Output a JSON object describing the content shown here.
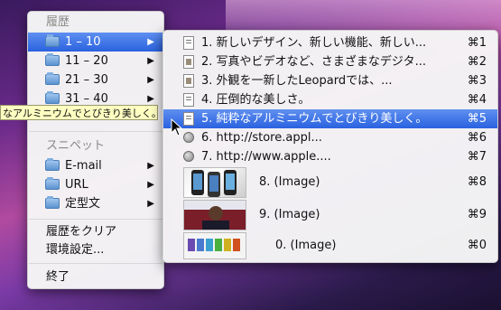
{
  "main_menu": {
    "header_history": "履歴",
    "history_groups": [
      {
        "label": "1 – 10"
      },
      {
        "label": "11 – 20"
      },
      {
        "label": "21 – 30"
      },
      {
        "label": "31 – 40"
      }
    ],
    "header_snippets": "スニペット",
    "snippet_folders": [
      {
        "label": "E-mail"
      },
      {
        "label": "URL"
      },
      {
        "label": "定型文"
      }
    ],
    "clear_history": "履歴をクリア",
    "preferences": "環境設定...",
    "quit": "終了"
  },
  "tooltip": "なアルミニウムでとびきり美しく。",
  "submenu": {
    "items": [
      {
        "label": "1. 新しいデザイン、新しい機能、新しい...",
        "shortcut": "⌘1",
        "icon": "document-icon"
      },
      {
        "label": "2. 写真やビデオなど、さまざまなデジタ...",
        "shortcut": "⌘2",
        "icon": "image-document-icon"
      },
      {
        "label": "3. 外観を一新したLeopardでは、...",
        "shortcut": "⌘3",
        "icon": "image-document-icon"
      },
      {
        "label": "4. 圧倒的な美しさ。",
        "shortcut": "⌘4",
        "icon": "document-icon"
      },
      {
        "label": "5. 純粋なアルミニウムでとびきり美しく。",
        "shortcut": "⌘5",
        "icon": "document-icon"
      },
      {
        "label": "6. http://store.appl...",
        "shortcut": "⌘6",
        "icon": "globe-icon"
      },
      {
        "label": "7. http://www.apple....",
        "shortcut": "⌘7",
        "icon": "globe-icon"
      },
      {
        "label": "8. (Image)",
        "shortcut": "⌘8",
        "icon": "iphone-thumbnail"
      },
      {
        "label": "9. (Image)",
        "shortcut": "⌘9",
        "icon": "portrait-thumbnail"
      },
      {
        "label": "0. (Image)",
        "shortcut": "⌘0",
        "icon": "ipod-thumbnail"
      }
    ]
  },
  "colors": {
    "highlight": "#2a62e0",
    "tooltip_bg": "#ffffc2"
  }
}
